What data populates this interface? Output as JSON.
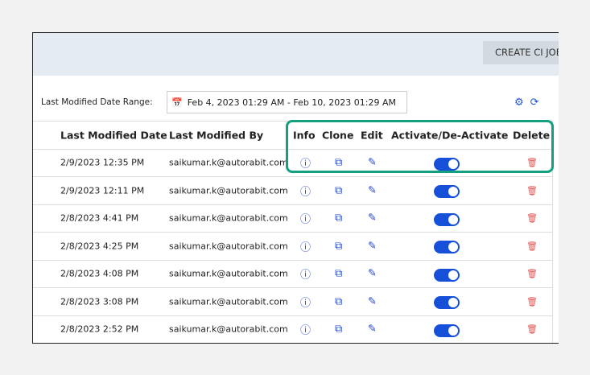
{
  "header": {
    "create_button": "CREATE CI JOB"
  },
  "filter": {
    "label": "Last Modified Date Range:",
    "value": "Feb 4, 2023 01:29 AM - Feb 10, 2023 01:29 AM"
  },
  "columns": [
    "Last Modified Date",
    "Last Modified By",
    "Info",
    "Clone",
    "Edit",
    "Activate/De-Activate",
    "Delete"
  ],
  "rows": [
    {
      "date": "2/9/2023 12:35 PM",
      "by": "saikumar.k@autorabit.com",
      "active": true
    },
    {
      "date": "2/9/2023 12:11 PM",
      "by": "saikumar.k@autorabit.com",
      "active": true
    },
    {
      "date": "2/8/2023 4:41 PM",
      "by": "saikumar.k@autorabit.com",
      "active": true
    },
    {
      "date": "2/8/2023 4:25 PM",
      "by": "saikumar.k@autorabit.com",
      "active": true
    },
    {
      "date": "2/8/2023 4:08 PM",
      "by": "saikumar.k@autorabit.com",
      "active": true
    },
    {
      "date": "2/8/2023 3:08 PM",
      "by": "saikumar.k@autorabit.com",
      "active": true
    },
    {
      "date": "2/8/2023 2:52 PM",
      "by": "saikumar.k@autorabit.com",
      "active": true
    }
  ],
  "colors": {
    "highlight": "#13a07e",
    "toggle": "#1650d8",
    "delete": "#e05555"
  }
}
